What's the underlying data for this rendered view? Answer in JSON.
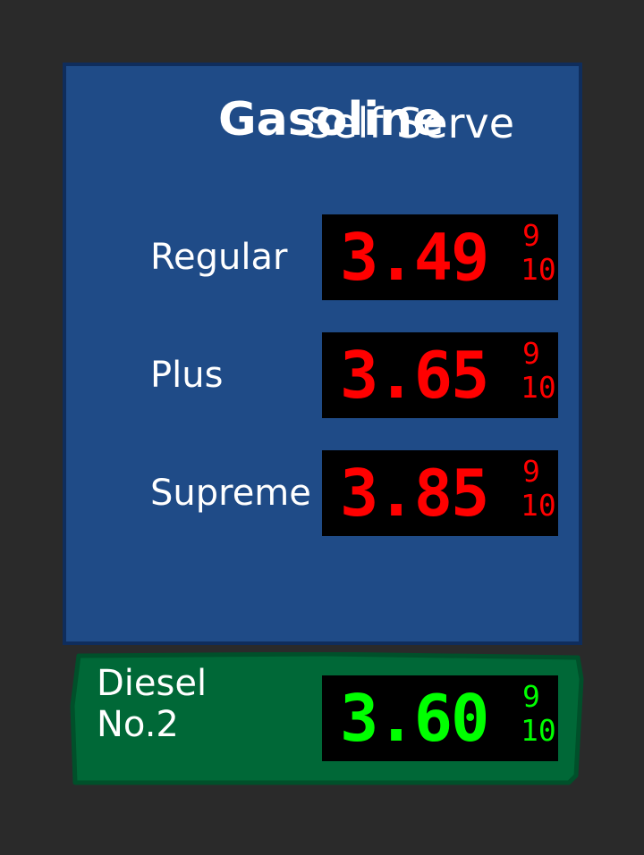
{
  "sign": {
    "title_primary": "Gasoline",
    "title_secondary": "Self Serve"
  },
  "grades": [
    {
      "name": "Regular",
      "price": "3.49",
      "fraction_num": "9",
      "fraction_den": "10"
    },
    {
      "name": "Plus",
      "price": "3.65",
      "fraction_num": "9",
      "fraction_den": "10"
    },
    {
      "name": "Supreme",
      "price": "3.85",
      "fraction_num": "9",
      "fraction_den": "10"
    }
  ],
  "diesel": {
    "line1": "Diesel",
    "line2": "No.2",
    "price": "3.60",
    "fraction_num": "9",
    "fraction_den": "10"
  },
  "colors": {
    "background": "#2a2a2a",
    "sign_panel": "#1f4b87",
    "diesel_panel": "#006837",
    "gas_digits": "#ff0000",
    "diesel_digits": "#00ff00"
  }
}
